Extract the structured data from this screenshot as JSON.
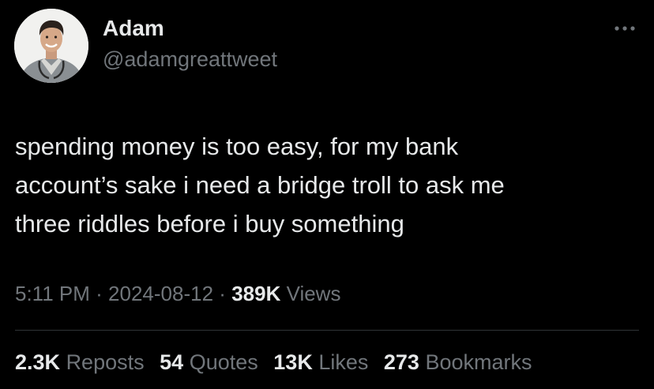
{
  "author": {
    "display_name": "Adam",
    "handle": "@adamgreattweet"
  },
  "tweet": {
    "text": "spending money is too easy, for my bank\naccount’s sake i need a bridge troll to ask me\nthree riddles before i buy something"
  },
  "meta": {
    "time": "5:11 PM",
    "separator": "·",
    "date": "2024-08-12",
    "views_count": "389K",
    "views_label": "Views"
  },
  "stats": {
    "reposts_count": "2.3K",
    "reposts_label": "Reposts",
    "quotes_count": "54",
    "quotes_label": "Quotes",
    "likes_count": "13K",
    "likes_label": "Likes",
    "bookmarks_count": "273",
    "bookmarks_label": "Bookmarks"
  },
  "icons": {
    "more": "more-icon",
    "avatar": "avatar"
  },
  "colors": {
    "background": "#000000",
    "primary_text": "#e7e9ea",
    "secondary_text": "#71767b",
    "divider": "#2f3336"
  }
}
